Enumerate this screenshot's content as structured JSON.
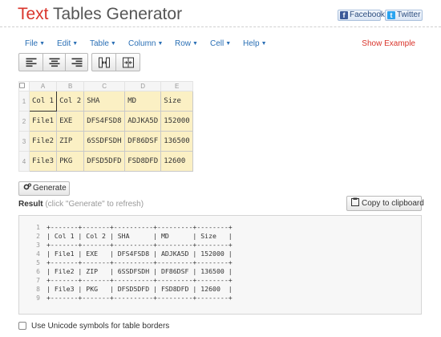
{
  "brand": {
    "word1": "Text",
    "word2": " Tables Generator"
  },
  "social": {
    "facebook": "Facebook",
    "twitter": "Twitter"
  },
  "menu": {
    "items": [
      "File",
      "Edit",
      "Table",
      "Column",
      "Row",
      "Cell",
      "Help"
    ],
    "show_example": "Show Example"
  },
  "toolbar": {
    "buttons": [
      "align-left-icon",
      "align-center-icon",
      "align-right-icon",
      "column-resize-icon",
      "column-fit-icon"
    ]
  },
  "grid": {
    "columns": [
      "A",
      "B",
      "C",
      "D",
      "E"
    ],
    "rows": [
      "1",
      "2",
      "3",
      "4"
    ],
    "cells": [
      [
        "Col 1",
        "Col 2",
        "SHA",
        "MD",
        "Size"
      ],
      [
        "File1",
        "EXE",
        "DFS4FSD8",
        "ADJKA5D",
        "152000"
      ],
      [
        "File2",
        "ZIP",
        "6SSDFSDH",
        "DF86DSF",
        "136500"
      ],
      [
        "File3",
        "PKG",
        "DFSD5DFD",
        "FSD8DFD",
        "12600"
      ]
    ]
  },
  "generate": {
    "label": "Generate"
  },
  "result": {
    "label": "Result",
    "hint": "(click \"Generate\" to refresh)",
    "copy_label": "Copy to clipboard"
  },
  "output": {
    "lines": [
      "+-------+-------+----------+---------+--------+",
      "| Col 1 | Col 2 | SHA      | MD      | Size   |",
      "+-------+-------+----------+---------+--------+",
      "| File1 | EXE   | DFS4FSD8 | ADJKA5D | 152000 |",
      "+-------+-------+----------+---------+--------+",
      "| File2 | ZIP   | 6SSDFSDH | DF86DSF | 136500 |",
      "+-------+-------+----------+---------+--------+",
      "| File3 | PKG   | DFSD5DFD | FSD8DFD | 12600  |",
      "+-------+-------+----------+---------+--------+"
    ]
  },
  "options": {
    "unicode_label": "Use Unicode symbols for table borders"
  }
}
